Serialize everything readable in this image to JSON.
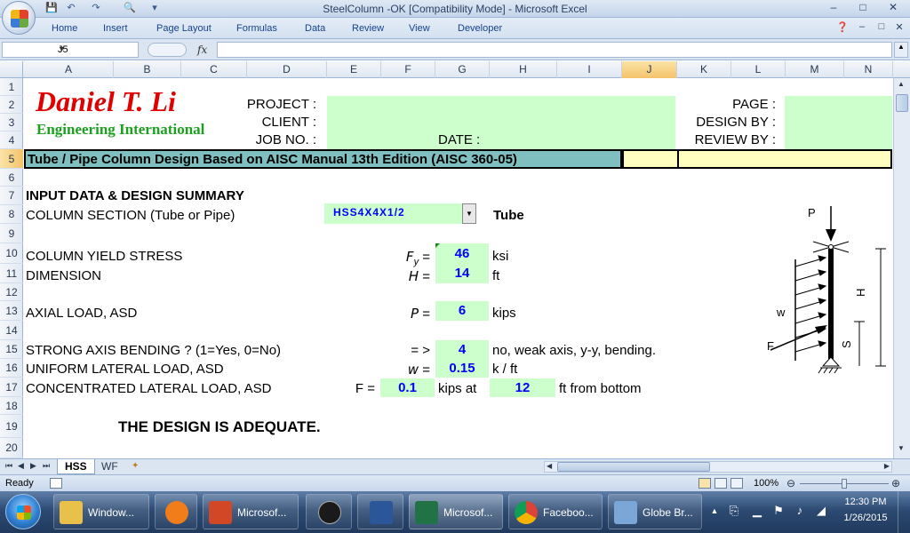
{
  "window": {
    "title": "SteelColumn -OK  [Compatibility Mode] - Microsoft Excel",
    "min_icon": "minimize-icon",
    "max_icon": "maximize-icon",
    "close_icon": "close-icon"
  },
  "ribbon": {
    "tabs": [
      "Home",
      "Insert",
      "Page Layout",
      "Formulas",
      "Data",
      "Review",
      "View",
      "Developer"
    ]
  },
  "formula_bar": {
    "name_box": "J5",
    "fx_label": "fx",
    "formula": ""
  },
  "columns": [
    "A",
    "B",
    "C",
    "D",
    "E",
    "F",
    "G",
    "H",
    "I",
    "J",
    "K",
    "L",
    "M",
    "N"
  ],
  "selected_column": "J",
  "rows": [
    "1",
    "2",
    "3",
    "4",
    "5",
    "6",
    "7",
    "8",
    "9",
    "10",
    "11",
    "12",
    "13",
    "14",
    "15",
    "16",
    "17",
    "18",
    "19",
    "20"
  ],
  "selected_row": "5",
  "sheet": {
    "company_name": "Daniel T. Li",
    "company_sub": "Engineering International",
    "project_label": "PROJECT :",
    "client_label": "CLIENT :",
    "jobno_label": "JOB NO. :",
    "date_label": "DATE :",
    "page_label": "PAGE :",
    "designby_label": "DESIGN BY :",
    "reviewby_label": "REVIEW BY :",
    "banner": "Tube / Pipe Column Design Based on AISC Manual 13th Edition (AISC 360-05)",
    "section_heading": "INPUT DATA & DESIGN SUMMARY",
    "column_section_label": "COLUMN SECTION (Tube or Pipe)",
    "column_section_value": "HSS4X4X1/2",
    "column_section_type": "Tube",
    "yield_label": "COLUMN YIELD STRESS",
    "yield_sym": "F",
    "yield_sub": "y",
    "yield_value": "46",
    "yield_unit": "ksi",
    "dim_label": "DIMENSION",
    "dim_sym": "H",
    "dim_value": "14",
    "dim_unit": "ft",
    "axial_label": "AXIAL LOAD, ASD",
    "axial_sym": "P",
    "axial_value": "6",
    "axial_unit": "kips",
    "strong_label": "STRONG AXIS BENDING ? (1=Yes, 0=No)",
    "strong_sym": "= >",
    "strong_value": "4",
    "strong_note": "no, weak axis, y-y, bending.",
    "uniform_label": "UNIFORM LATERAL LOAD, ASD",
    "uniform_sym": "w",
    "uniform_value": "0.15",
    "uniform_unit": "k / ft",
    "conc_label": "CONCENTRATED LATERAL LOAD, ASD",
    "conc_sym": "F =",
    "conc_value": "0.1",
    "conc_unit": "kips at",
    "conc_pos_value": "12",
    "conc_pos_unit": "ft from bottom",
    "eq": "=",
    "result": "THE DESIGN IS ADEQUATE.",
    "diagram": {
      "p": "P",
      "w": "w",
      "f": "F",
      "h": "H",
      "s": "S"
    }
  },
  "sheet_tabs": [
    "HSS",
    "WF"
  ],
  "status": {
    "ready": "Ready",
    "zoom": "100%"
  },
  "taskbar": {
    "items": [
      {
        "label": "Window...",
        "icon": "folder-icon",
        "color": "#e8c04a"
      },
      {
        "label": "",
        "icon": "media-player-icon",
        "color": "#f07d1a"
      },
      {
        "label": "Microsof...",
        "icon": "powerpoint-icon",
        "color": "#d24726"
      },
      {
        "label": "",
        "icon": "hp-icon",
        "color": "#1a1a1a"
      },
      {
        "label": "",
        "icon": "word-icon",
        "color": "#2b579a"
      },
      {
        "label": "Microsof...",
        "icon": "excel-icon",
        "color": "#217346"
      },
      {
        "label": "Faceboo...",
        "icon": "chrome-icon",
        "color": "#db4437"
      },
      {
        "label": "Globe Br...",
        "icon": "globe-icon",
        "color": "#7aa6d8"
      }
    ],
    "time": "12:30 PM",
    "date": "1/26/2015"
  }
}
